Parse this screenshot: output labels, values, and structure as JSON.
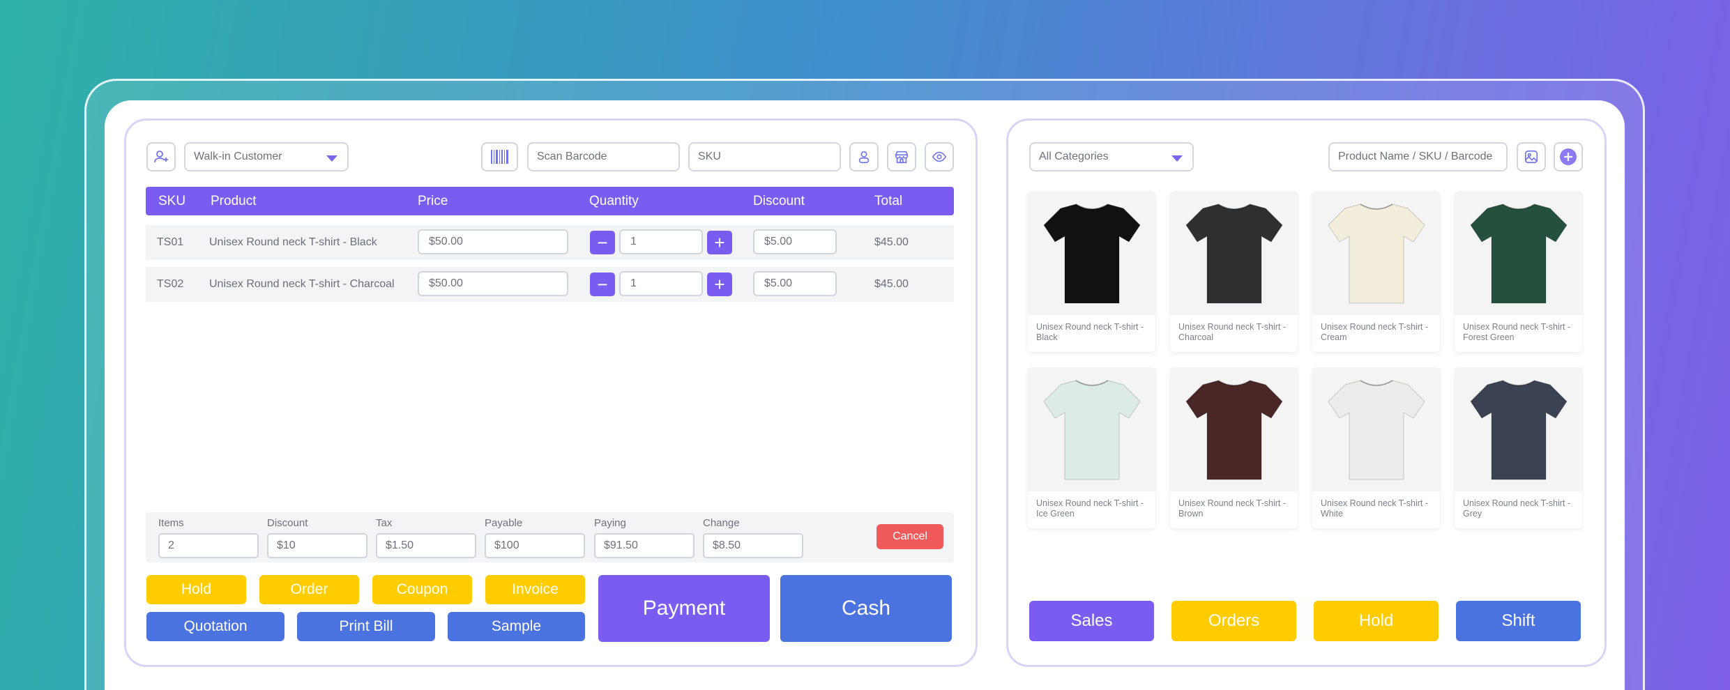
{
  "customer": {
    "selected": "Walk-in Customer"
  },
  "scan": {
    "barcode_placeholder": "Scan Barcode",
    "sku_placeholder": "SKU"
  },
  "table": {
    "headers": {
      "sku": "SKU",
      "product": "Product",
      "price": "Price",
      "quantity": "Quantity",
      "discount": "Discount",
      "total": "Total"
    },
    "rows": [
      {
        "sku": "TS01",
        "product": "Unisex Round neck T-shirt - Black",
        "price": "$50.00",
        "qty": "1",
        "discount": "$5.00",
        "total": "$45.00"
      },
      {
        "sku": "TS02",
        "product": "Unisex Round neck T-shirt - Charcoal",
        "price": "$50.00",
        "qty": "1",
        "discount": "$5.00",
        "total": "$45.00"
      }
    ]
  },
  "summary": {
    "items_label": "Items",
    "items": "2",
    "discount_label": "Discount",
    "discount": "$10",
    "tax_label": "Tax",
    "tax": "$1.50",
    "payable_label": "Payable",
    "payable": "$100",
    "paying_label": "Paying",
    "paying": "$91.50",
    "change_label": "Change",
    "change": "$8.50",
    "cancel": "Cancel"
  },
  "actions": {
    "hold": "Hold",
    "order": "Order",
    "coupon": "Coupon",
    "invoice": "Invoice",
    "quotation": "Quotation",
    "print_bill": "Print Bill",
    "sample": "Sample",
    "payment": "Payment",
    "cash": "Cash"
  },
  "catalog": {
    "category": "All Categories",
    "search_placeholder": "Product Name / SKU / Barcode",
    "products": [
      {
        "name": "Unisex Round neck T-shirt - Black",
        "color": "#111111"
      },
      {
        "name": "Unisex Round neck T-shirt - Charcoal",
        "color": "#2e2f31"
      },
      {
        "name": "Unisex Round neck T-shirt - Cream",
        "color": "#f3eedb"
      },
      {
        "name": "Unisex Round neck T-shirt - Forest Green",
        "color": "#24503d"
      },
      {
        "name": "Unisex Round neck T-shirt - Ice Green",
        "color": "#dcebe6"
      },
      {
        "name": "Unisex Round neck T-shirt - Brown",
        "color": "#4a2626"
      },
      {
        "name": "Unisex Round neck T-shirt - White",
        "color": "#ecedea"
      },
      {
        "name": "Unisex Round neck T-shirt - Grey",
        "color": "#3b4253"
      }
    ]
  },
  "nav": {
    "sales": "Sales",
    "orders": "Orders",
    "hold": "Hold",
    "shift": "Shift"
  },
  "colors": {
    "accent": "#7a5df0",
    "blue": "#4a73e0",
    "yellow": "#ffcc00",
    "danger": "#f05a5a"
  }
}
